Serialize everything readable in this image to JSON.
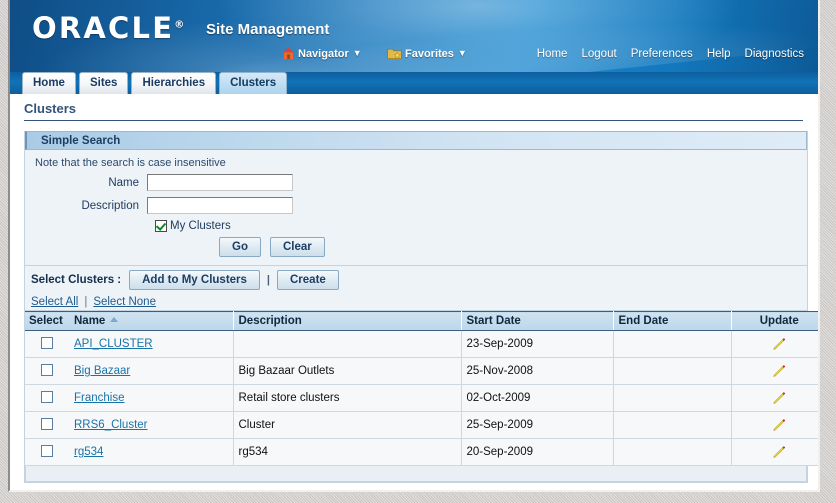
{
  "brand": {
    "logo_text": "ORACLE",
    "logo_tm": "®",
    "app_title": "Site Management"
  },
  "header_menus": {
    "navigator": {
      "label": "Navigator",
      "icon": "home-icon",
      "caret": "▼"
    },
    "favorites": {
      "label": "Favorites",
      "icon": "favorites-folder-icon",
      "caret": "▼"
    }
  },
  "global_links": [
    {
      "label": "Home"
    },
    {
      "label": "Logout"
    },
    {
      "label": "Preferences"
    },
    {
      "label": "Help"
    },
    {
      "label": "Diagnostics"
    }
  ],
  "tabs": [
    {
      "label": "Home",
      "active": false
    },
    {
      "label": "Sites",
      "active": false
    },
    {
      "label": "Hierarchies",
      "active": false
    },
    {
      "label": "Clusters",
      "active": true
    }
  ],
  "page": {
    "title": "Clusters"
  },
  "search": {
    "header": "Simple Search",
    "note": "Note that the search is case insensitive",
    "name_label": "Name",
    "name_value": "",
    "name_placeholder": "",
    "description_label": "Description",
    "description_value": "",
    "description_placeholder": "",
    "my_clusters_label": "My Clusters",
    "my_clusters_checked": true,
    "go_label": "Go",
    "clear_label": "Clear"
  },
  "actions": {
    "select_clusters_label": "Select Clusters :",
    "add_to_my_clusters_label": "Add to My Clusters",
    "separator": "|",
    "create_label": "Create"
  },
  "select_links": {
    "select_all": "Select All",
    "separator": "|",
    "select_none": "Select None"
  },
  "table": {
    "columns": [
      {
        "key": "select",
        "label": "Select"
      },
      {
        "key": "name",
        "label": "Name",
        "sorted": "asc"
      },
      {
        "key": "description",
        "label": "Description"
      },
      {
        "key": "start_date",
        "label": "Start Date"
      },
      {
        "key": "end_date",
        "label": "End Date"
      },
      {
        "key": "update",
        "label": "Update"
      }
    ],
    "rows": [
      {
        "checked": false,
        "name": "API_CLUSTER",
        "description": "",
        "start_date": "23-Sep-2009",
        "end_date": "",
        "update_icon": "pencil-icon"
      },
      {
        "checked": false,
        "name": "Big Bazaar",
        "description": "Big Bazaar Outlets",
        "start_date": "25-Nov-2008",
        "end_date": "",
        "update_icon": "pencil-icon"
      },
      {
        "checked": false,
        "name": "Franchise",
        "description": "Retail store clusters",
        "start_date": "02-Oct-2009",
        "end_date": "",
        "update_icon": "pencil-icon"
      },
      {
        "checked": false,
        "name": "RRS6_Cluster",
        "description": "Cluster",
        "start_date": "25-Sep-2009",
        "end_date": "",
        "update_icon": "pencil-icon"
      },
      {
        "checked": false,
        "name": "rg534",
        "description": "rg534",
        "start_date": "20-Sep-2009",
        "end_date": "",
        "update_icon": "pencil-icon"
      }
    ]
  },
  "colors": {
    "brand_blue": "#1f7cc0",
    "tab_active": "#bcdcf2",
    "link_blue": "#1a73a8",
    "header_text": "#10273f",
    "pencil_yellow": "#f2e14c",
    "pencil_tip_red": "#e03a2a"
  }
}
